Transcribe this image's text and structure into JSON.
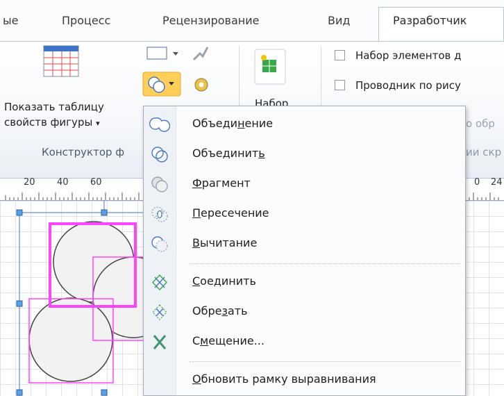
{
  "tabs": [
    "ые",
    "Процесс",
    "Рецензирование",
    "Вид",
    "Разработчик"
  ],
  "ribbon": {
    "show_table_line1": "Показать таблицу",
    "show_table_line2": "свойств фигуры",
    "dropdown_arrow": "▾",
    "shapes_group_label": "Конструктор ф",
    "set_label": "Набор",
    "check1_label": "Набор элементов д",
    "check2_label": "Проводник по рису",
    "faded_right1": "о обр",
    "faded_right2": "ии скр"
  },
  "ruler": [
    "20",
    "40",
    "60",
    "0",
    "24"
  ],
  "menu": {
    "items": [
      {
        "pre": "Объеди",
        "u": "н",
        "post": "ение",
        "icon": "union-icon"
      },
      {
        "pre": "Объединит",
        "u": "ь",
        "post": "",
        "icon": "combine-icon"
      },
      {
        "pre": "",
        "u": "Ф",
        "post": "рагмент",
        "icon": "fragment-icon"
      },
      {
        "pre": "",
        "u": "П",
        "post": "ересечение",
        "icon": "intersect-icon"
      },
      {
        "pre": "",
        "u": "В",
        "post": "ычитание",
        "icon": "subtract-icon"
      },
      {
        "pre": "",
        "u": "С",
        "post": "оединить",
        "icon": "join-icon"
      },
      {
        "pre": "Обре",
        "u": "з",
        "post": "ать",
        "icon": "trim-icon"
      },
      {
        "pre": "С",
        "u": "м",
        "post": "ещение...",
        "icon": "offset-icon"
      },
      {
        "pre": "",
        "u": "О",
        "post": "бновить рамку выравнивания",
        "icon": ""
      }
    ]
  },
  "colors": {
    "accent": "#3a78c8",
    "selection": "#ff44ff",
    "menu_bg": "#fbfcfd"
  }
}
